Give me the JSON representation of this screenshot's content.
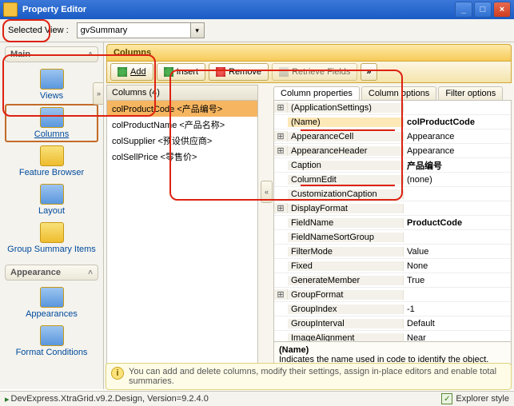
{
  "window": {
    "title": "Property Editor"
  },
  "view": {
    "label": "Selected View :",
    "value": "gvSummary"
  },
  "main": {
    "group_main": "Main",
    "group_appearance": "Appearance",
    "items": {
      "views": "Views",
      "columns": "Columns",
      "feature_browser": "Feature Browser",
      "layout": "Layout",
      "group_summary_items": "Group Summary Items",
      "appearances": "Appearances",
      "format_conditions": "Format Conditions"
    }
  },
  "panel": {
    "title": "Columns",
    "columns_count": "Columns (4)"
  },
  "toolbar": {
    "add": "Add",
    "insert": "Insert",
    "remove": "Remove",
    "retrieve": "Retrieve Fields",
    "chev": "»"
  },
  "collapse": {
    "right": "»",
    "left": "«"
  },
  "column_items": {
    "c0": "colProductCode <产品编号>",
    "c1": "colProductName <产品名称>",
    "c2": "colSupplier <预设供应商>",
    "c3": "colSellPrice <零售价>"
  },
  "tabs": {
    "props": "Column properties",
    "opts": "Column options",
    "filter": "Filter options"
  },
  "props": {
    "appset": {
      "n": "(ApplicationSettings)",
      "v": ""
    },
    "name": {
      "n": "(Name)",
      "v": "colProductCode"
    },
    "apc": {
      "n": "AppearanceCell",
      "v": "Appearance"
    },
    "aph": {
      "n": "AppearanceHeader",
      "v": "Appearance"
    },
    "cap": {
      "n": "Caption",
      "v": "产品编号"
    },
    "ced": {
      "n": "ColumnEdit",
      "v": "(none)"
    },
    "cust": {
      "n": "CustomizationCaption",
      "v": ""
    },
    "df": {
      "n": "DisplayFormat",
      "v": ""
    },
    "fn": {
      "n": "FieldName",
      "v": "ProductCode"
    },
    "fnsg": {
      "n": "FieldNameSortGroup",
      "v": ""
    },
    "fm": {
      "n": "FilterMode",
      "v": "Value"
    },
    "fx": {
      "n": "Fixed",
      "v": "None"
    },
    "gm": {
      "n": "GenerateMember",
      "v": "True"
    },
    "gf": {
      "n": "GroupFormat",
      "v": ""
    },
    "gi": {
      "n": "GroupIndex",
      "v": "-1"
    },
    "gint": {
      "n": "GroupInterval",
      "v": "Default"
    },
    "ia": {
      "n": "ImageAlignment",
      "v": "Near"
    }
  },
  "desc": {
    "name": "(Name)",
    "text": "Indicates the name used in code to identify the object."
  },
  "hint": "You can add and delete columns, modify their settings, assign in-place editors and enable total summaries.",
  "status": {
    "text": "DevExpress.XtraGrid.v9.2.Design, Version=9.2.4.0",
    "explorer": "Explorer style"
  }
}
